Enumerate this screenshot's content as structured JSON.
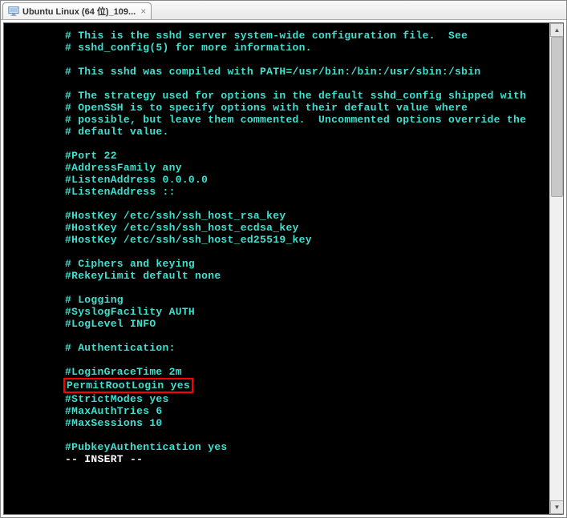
{
  "tab": {
    "title": "Ubuntu Linux (64 位)_109...",
    "close": "×"
  },
  "terminal": {
    "lines": [
      "# This is the sshd server system-wide configuration file.  See",
      "# sshd_config(5) for more information.",
      "",
      "# This sshd was compiled with PATH=/usr/bin:/bin:/usr/sbin:/sbin",
      "",
      "# The strategy used for options in the default sshd_config shipped with",
      "# OpenSSH is to specify options with their default value where",
      "# possible, but leave them commented.  Uncommented options override the",
      "# default value.",
      "",
      "#Port 22",
      "#AddressFamily any",
      "#ListenAddress 0.0.0.0",
      "#ListenAddress ::",
      "",
      "#HostKey /etc/ssh/ssh_host_rsa_key",
      "#HostKey /etc/ssh/ssh_host_ecdsa_key",
      "#HostKey /etc/ssh/ssh_host_ed25519_key",
      "",
      "# Ciphers and keying",
      "#RekeyLimit default none",
      "",
      "# Logging",
      "#SyslogFacility AUTH",
      "#LogLevel INFO",
      "",
      "# Authentication:",
      "",
      "#LoginGraceTime 2m"
    ],
    "highlighted_line": "PermitRootLogin yes",
    "lines_after": [
      "#StrictModes yes",
      "#MaxAuthTries 6",
      "#MaxSessions 10",
      "",
      "#PubkeyAuthentication yes"
    ],
    "mode": "-- INSERT --"
  }
}
